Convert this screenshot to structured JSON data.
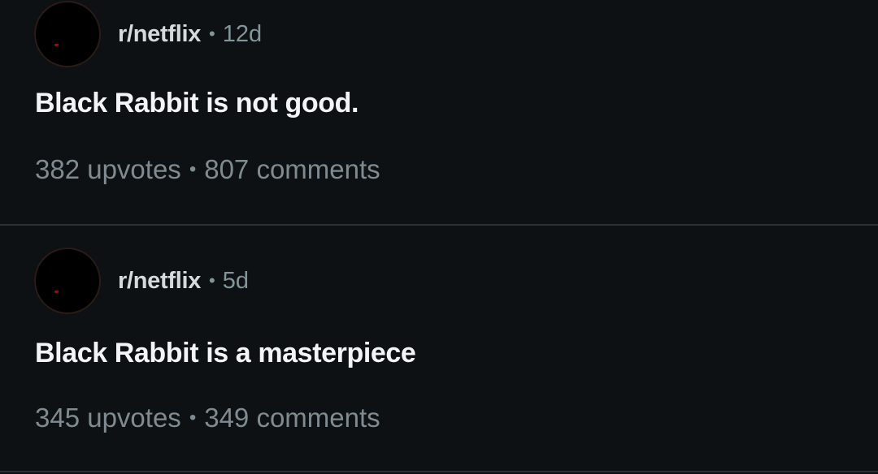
{
  "posts": [
    {
      "subreddit": "r/netflix",
      "separator": "•",
      "age": "12d",
      "title": "Black Rabbit is not good.",
      "upvotes": "382 upvotes",
      "stats_separator": "•",
      "comments": "807 comments",
      "avatar_icon": "subreddit-avatar-icon"
    },
    {
      "subreddit": "r/netflix",
      "separator": "•",
      "age": "5d",
      "title": "Black Rabbit is a masterpiece",
      "upvotes": "345 upvotes",
      "stats_separator": "•",
      "comments": "349 comments",
      "avatar_icon": "subreddit-avatar-icon"
    }
  ],
  "colors": {
    "background": "#0e1113",
    "divider": "#2a3236",
    "title": "#f2f4f5",
    "subreddit": "#d7dadc",
    "muted": "#82959b",
    "avatar_accent": "#8a1010"
  }
}
